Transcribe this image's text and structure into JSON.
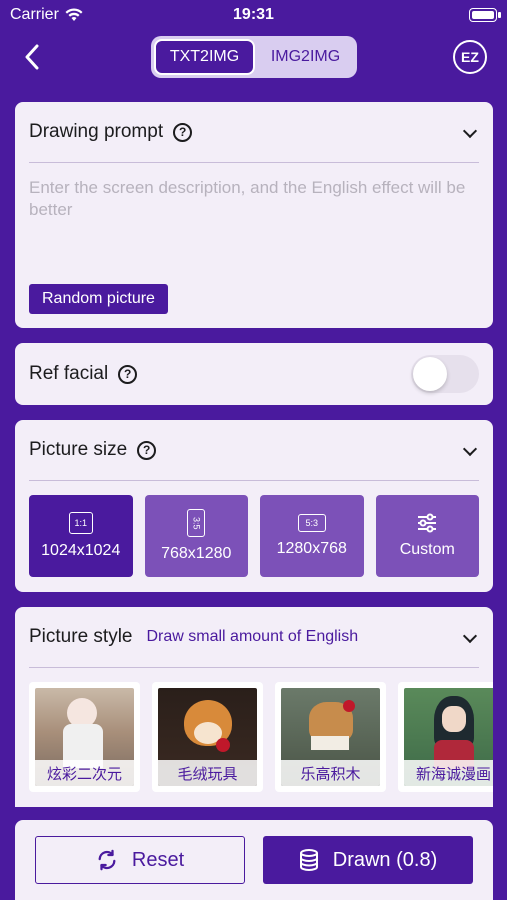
{
  "status": {
    "carrier": "Carrier",
    "time": "19:31"
  },
  "nav": {
    "tabs": [
      "TXT2IMG",
      "IMG2IMG"
    ],
    "active_tab": "TXT2IMG",
    "ez_label": "EZ"
  },
  "prompt": {
    "title": "Drawing prompt",
    "placeholder": "Enter the screen description, and the English effect will be better",
    "random_label": "Random picture"
  },
  "ref_facial": {
    "title": "Ref facial",
    "enabled": false
  },
  "picture_size": {
    "title": "Picture size",
    "options": [
      {
        "ratio": "1:1",
        "label": "1024x1024",
        "active": true
      },
      {
        "ratio": "3:5",
        "label": "768x1280",
        "active": false
      },
      {
        "ratio": "5:3",
        "label": "1280x768",
        "active": false
      },
      {
        "ratio": "",
        "label": "Custom",
        "active": false
      }
    ]
  },
  "picture_style": {
    "title": "Picture style",
    "subtitle": "Draw small amount of English",
    "styles": [
      "炫彩二次元",
      "毛绒玩具",
      "乐高积木",
      "新海诚漫画"
    ]
  },
  "actions": {
    "reset_label": "Reset",
    "drawn_label": "Drawn (0.8)"
  },
  "colors": {
    "accent": "#4a1a9e",
    "card": "#f3eef8",
    "secondary": "#7c51b8"
  }
}
